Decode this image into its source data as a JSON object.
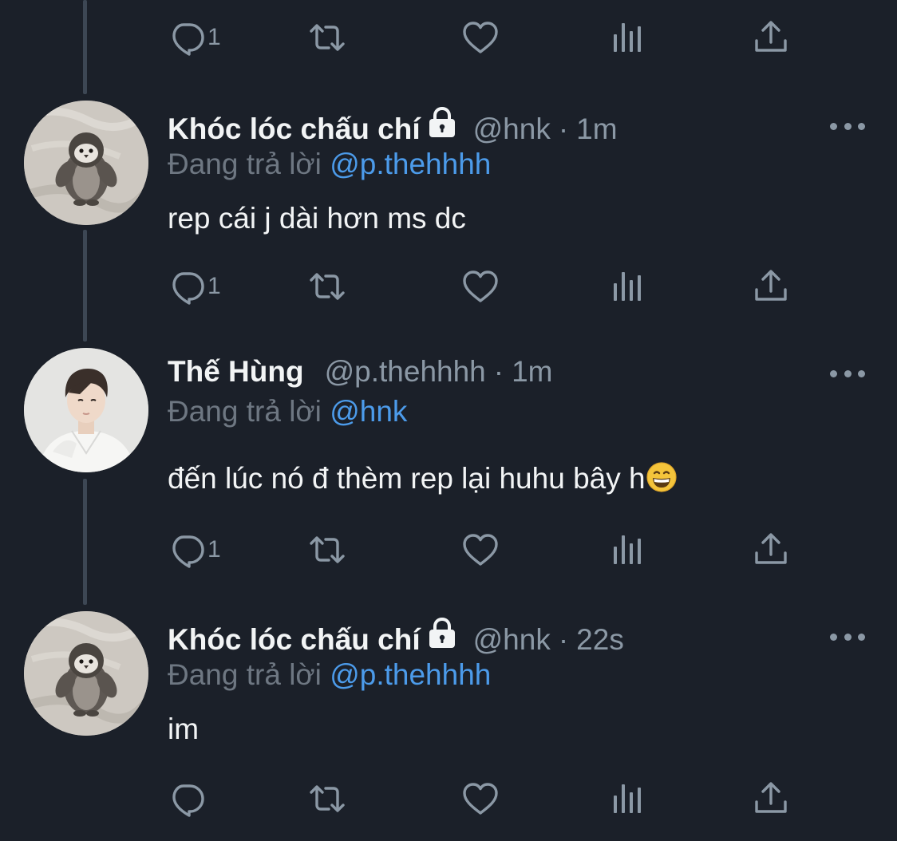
{
  "top_actions": {
    "reply_count": "1"
  },
  "tweets": [
    {
      "name": "Khóc lóc chấu chí",
      "handle": "@hnk",
      "separator": "·",
      "time": "1m",
      "reply_label": "Đang trả lời",
      "reply_to": "@p.thehhhh",
      "text": "rep cái j dài hơn ms dc",
      "reply_count": "1",
      "avatar": "penguin-plush",
      "locked": true
    },
    {
      "name": "Thế Hùng",
      "handle": "@p.thehhhh",
      "separator": "·",
      "time": "1m",
      "reply_label": "Đang trả lời",
      "reply_to": "@hnk",
      "text": "đến lúc nó đ thèm rep lại huhu bây h",
      "emoji": "grinning-face",
      "reply_count": "1",
      "avatar": "person-white-shirt",
      "locked": false
    },
    {
      "name": "Khóc lóc chấu chí",
      "handle": "@hnk",
      "separator": "·",
      "time": "22s",
      "reply_label": "Đang trả lời",
      "reply_to": "@p.thehhhh",
      "text": "im",
      "reply_count": "",
      "avatar": "penguin-plush",
      "locked": true
    }
  ],
  "colors": {
    "background": "#1b2029",
    "muted_text": "#8b98a5",
    "link": "#4c9bea",
    "thread_line": "#3d4754"
  },
  "icons": [
    "reply-icon",
    "retweet-icon",
    "like-icon",
    "stats-icon",
    "share-icon",
    "lock-icon",
    "more-icon"
  ]
}
